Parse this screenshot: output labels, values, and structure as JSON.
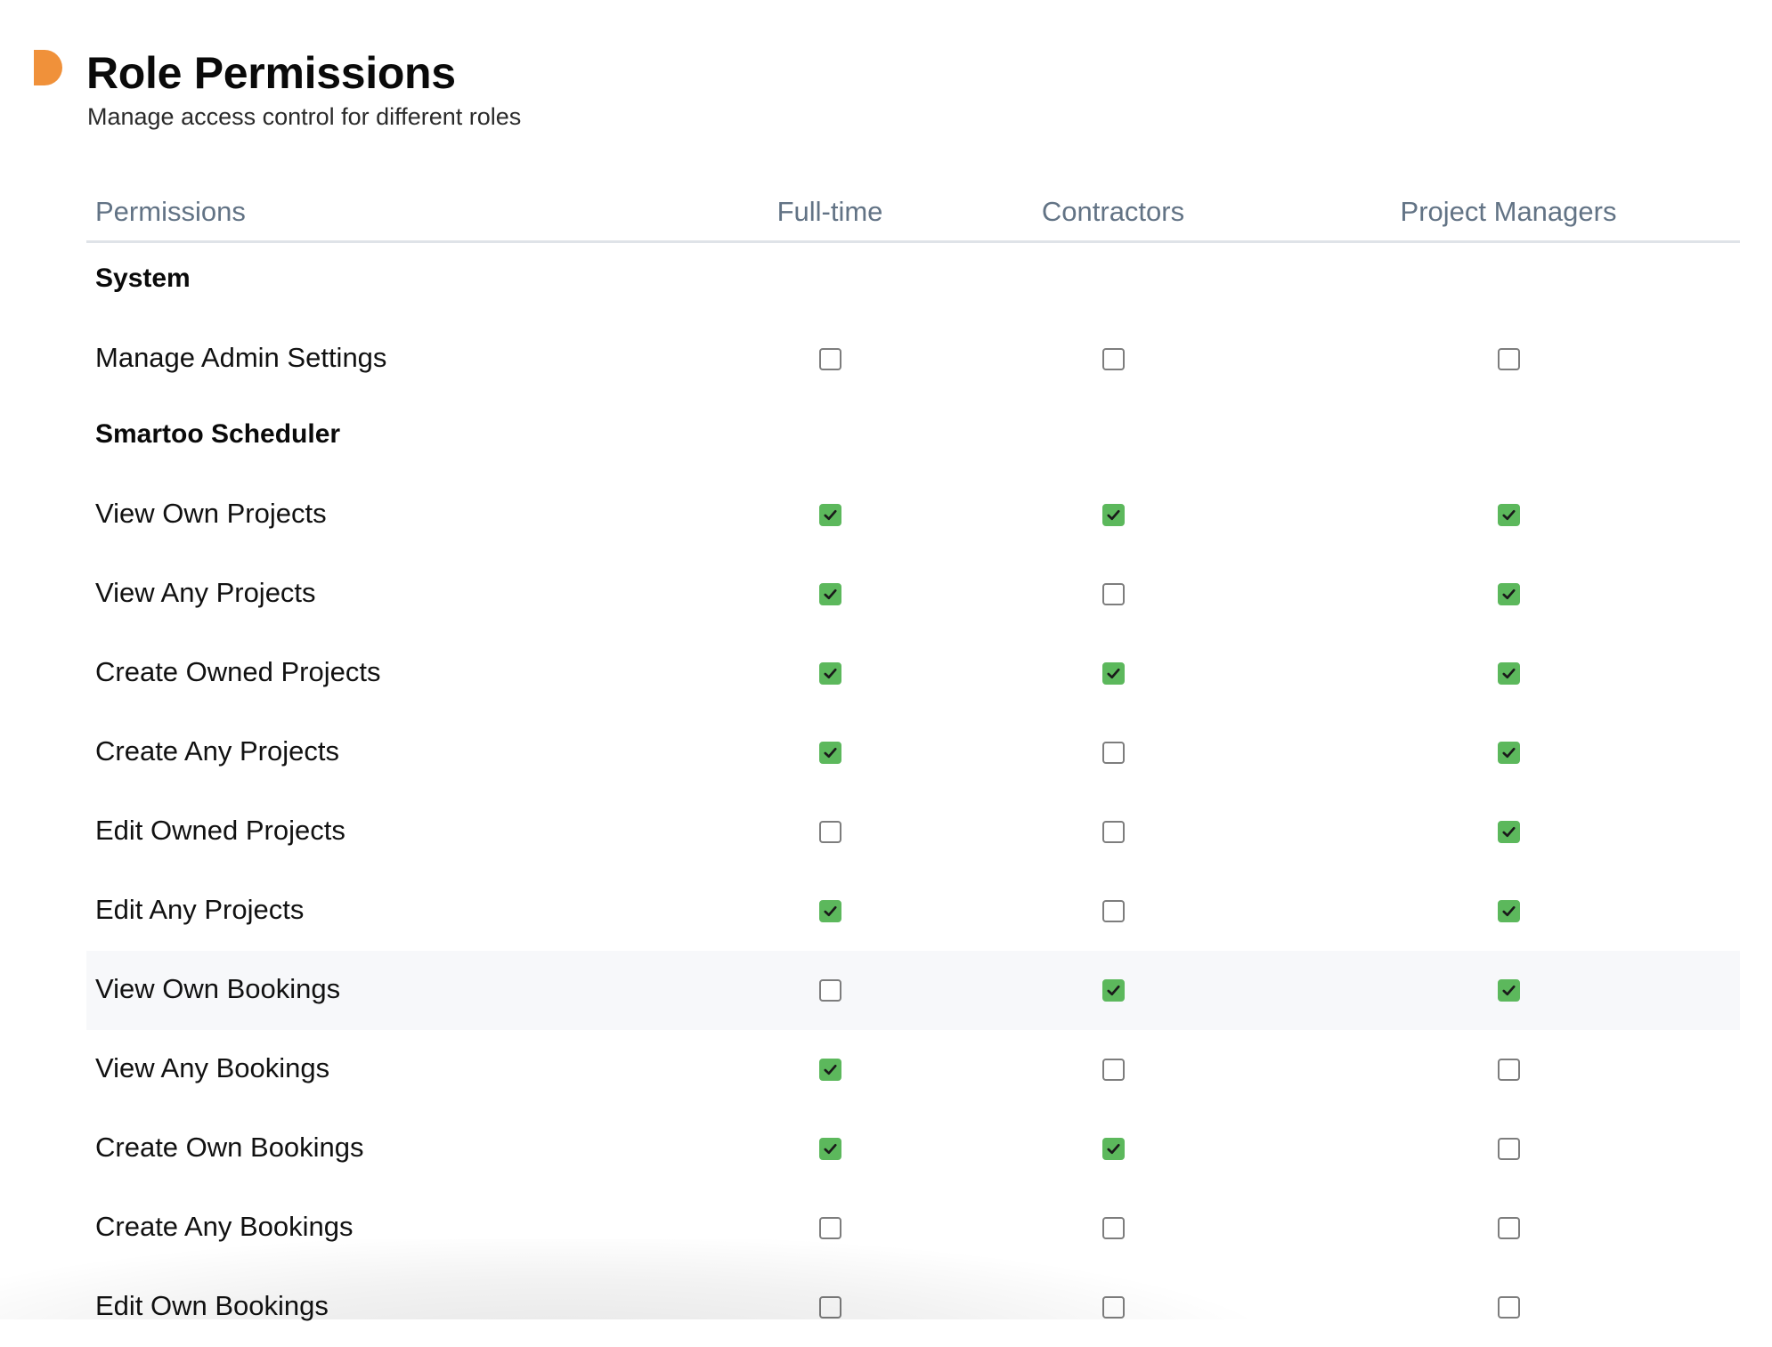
{
  "header": {
    "title": "Role Permissions",
    "subtitle": "Manage access control for different roles",
    "accent_color": "#f0913a"
  },
  "table": {
    "permission_column_label": "Permissions",
    "roles": [
      "Full-time",
      "Contractors",
      "Project Managers"
    ],
    "checked_color": "#5cb85c",
    "sections": [
      {
        "name": "System",
        "rows": [
          {
            "label": "Manage Admin Settings",
            "values": [
              false,
              false,
              false
            ]
          }
        ]
      },
      {
        "name": "Smartoo Scheduler",
        "rows": [
          {
            "label": "View Own Projects",
            "values": [
              true,
              true,
              true
            ]
          },
          {
            "label": "View Any Projects",
            "values": [
              true,
              false,
              true
            ]
          },
          {
            "label": "Create Owned Projects",
            "values": [
              true,
              true,
              true
            ]
          },
          {
            "label": "Create Any Projects",
            "values": [
              true,
              false,
              true
            ]
          },
          {
            "label": "Edit Owned Projects",
            "values": [
              false,
              false,
              true
            ]
          },
          {
            "label": "Edit Any Projects",
            "values": [
              true,
              false,
              true
            ]
          },
          {
            "label": "View Own Bookings",
            "values": [
              false,
              true,
              true
            ],
            "hovered": true
          },
          {
            "label": "View Any Bookings",
            "values": [
              true,
              false,
              false
            ]
          },
          {
            "label": "Create Own Bookings",
            "values": [
              true,
              true,
              false
            ]
          },
          {
            "label": "Create Any Bookings",
            "values": [
              false,
              false,
              false
            ]
          },
          {
            "label": "Edit Own Bookings",
            "values": [
              false,
              false,
              false
            ]
          }
        ]
      }
    ]
  }
}
